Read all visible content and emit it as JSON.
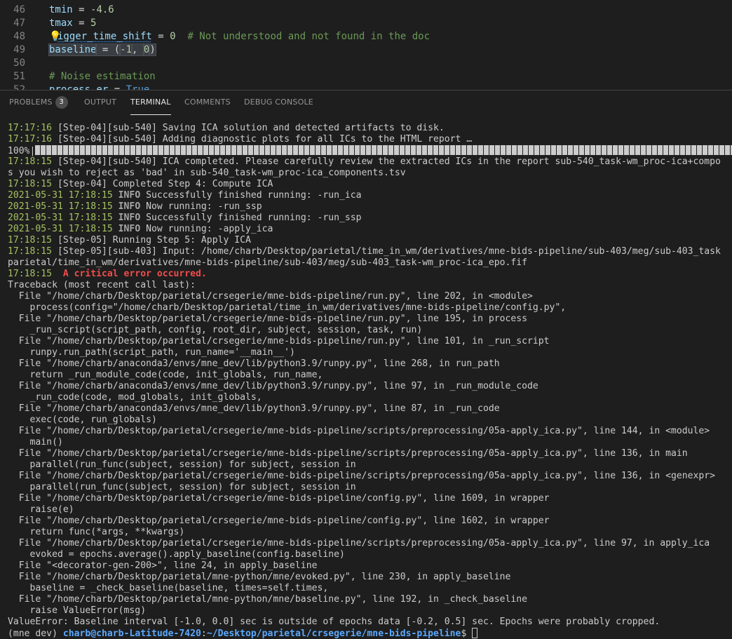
{
  "editor": {
    "lines": [
      {
        "num": "46",
        "var": "tmin",
        "op": " = ",
        "val": "-4.6"
      },
      {
        "num": "47",
        "var": "tmax",
        "op": " = ",
        "val": "5"
      },
      {
        "num": "48",
        "var": "igger_time_shift",
        "op": " = ",
        "val": "0",
        "comment": "  # Not understood and not found in the doc"
      },
      {
        "num": "49",
        "var": "baseline",
        "op": " = (",
        "val": "-1",
        "sep": ", ",
        "val2": "0",
        "close": ")"
      },
      {
        "num": "50"
      },
      {
        "num": "51",
        "comment": "# Noise estimation"
      },
      {
        "num": "52",
        "var": "process_er",
        "op": " = ",
        "val": "True"
      }
    ]
  },
  "panel": {
    "tabs": [
      {
        "label": "PROBLEMS",
        "badge": "3"
      },
      {
        "label": "OUTPUT"
      },
      {
        "label": "TERMINAL"
      },
      {
        "label": "COMMENTS"
      },
      {
        "label": "DEBUG CONSOLE"
      }
    ],
    "active_tab": "TERMINAL"
  },
  "terminal": {
    "lines": [
      {
        "ts": "17:17:16",
        "text": " [Step-04][sub-540] Saving ICA solution and detected artifacts to disk."
      },
      {
        "ts": "17:17:16",
        "text": " [Step-04][sub-540] Adding diagnostic plots for all ICs to the HTML report …"
      },
      {
        "progress": "100%|"
      },
      {
        "ts": "17:18:15",
        "text": " [Step-04][sub-540] ICA completed. Please carefully review the extracted ICs in the report sub-540_task-wm_proc-ica+compo"
      },
      {
        "text": "s you wish to reject as 'bad' in sub-540_task-wm_proc-ica_components.tsv"
      },
      {
        "ts": "17:18:15",
        "text": " [Step-04] Completed Step 4: Compute ICA"
      },
      {
        "ts": "2021-05-31 17:18:15",
        "level": " INFO",
        "text": " Successfully finished running: -run_ica"
      },
      {
        "ts": "2021-05-31 17:18:15",
        "level": " INFO",
        "text": " Now running: -run_ssp"
      },
      {
        "ts": "2021-05-31 17:18:15",
        "level": " INFO",
        "text": " Successfully finished running: -run_ssp"
      },
      {
        "ts": "2021-05-31 17:18:15",
        "level": " INFO",
        "text": " Now running: -apply_ica"
      },
      {
        "ts": "17:18:15",
        "text": " [Step-05] Running Step 5: Apply ICA"
      },
      {
        "ts": "17:18:15",
        "text": " [Step-05][sub-403] Input: /home/charb/Desktop/parietal/time_in_wm/derivatives/mne-bids-pipeline/sub-403/meg/sub-403_task"
      },
      {
        "text": "parietal/time_in_wm/derivatives/mne-bids-pipeline/sub-403/meg/sub-403_task-wm_proc-ica_epo.fif"
      },
      {
        "ts": "17:18:15",
        "error": "  A critical error occurred."
      },
      {
        "text": "Traceback (most recent call last):"
      },
      {
        "text": "  File \"/home/charb/Desktop/parietal/crsegerie/mne-bids-pipeline/run.py\", line 202, in <module>"
      },
      {
        "text": "    process(config=\"/home/charb/Desktop/parietal/time_in_wm/derivatives/mne-bids-pipeline/config.py\","
      },
      {
        "text": "  File \"/home/charb/Desktop/parietal/crsegerie/mne-bids-pipeline/run.py\", line 195, in process"
      },
      {
        "text": "    _run_script(script_path, config, root_dir, subject, session, task, run)"
      },
      {
        "text": "  File \"/home/charb/Desktop/parietal/crsegerie/mne-bids-pipeline/run.py\", line 101, in _run_script"
      },
      {
        "text": "    runpy.run_path(script_path, run_name='__main__')"
      },
      {
        "text": "  File \"/home/charb/anaconda3/envs/mne_dev/lib/python3.9/runpy.py\", line 268, in run_path"
      },
      {
        "text": "    return _run_module_code(code, init_globals, run_name,"
      },
      {
        "text": "  File \"/home/charb/anaconda3/envs/mne_dev/lib/python3.9/runpy.py\", line 97, in _run_module_code"
      },
      {
        "text": "    _run_code(code, mod_globals, init_globals,"
      },
      {
        "text": "  File \"/home/charb/anaconda3/envs/mne_dev/lib/python3.9/runpy.py\", line 87, in _run_code"
      },
      {
        "text": "    exec(code, run_globals)"
      },
      {
        "text": "  File \"/home/charb/Desktop/parietal/crsegerie/mne-bids-pipeline/scripts/preprocessing/05a-apply_ica.py\", line 144, in <module>"
      },
      {
        "text": "    main()"
      },
      {
        "text": "  File \"/home/charb/Desktop/parietal/crsegerie/mne-bids-pipeline/scripts/preprocessing/05a-apply_ica.py\", line 136, in main"
      },
      {
        "text": "    parallel(run_func(subject, session) for subject, session in"
      },
      {
        "text": "  File \"/home/charb/Desktop/parietal/crsegerie/mne-bids-pipeline/scripts/preprocessing/05a-apply_ica.py\", line 136, in <genexpr>"
      },
      {
        "text": "    parallel(run_func(subject, session) for subject, session in"
      },
      {
        "text": "  File \"/home/charb/Desktop/parietal/crsegerie/mne-bids-pipeline/config.py\", line 1609, in wrapper"
      },
      {
        "text": "    raise(e)"
      },
      {
        "text": "  File \"/home/charb/Desktop/parietal/crsegerie/mne-bids-pipeline/config.py\", line 1602, in wrapper"
      },
      {
        "text": "    return func(*args, **kwargs)"
      },
      {
        "text": "  File \"/home/charb/Desktop/parietal/crsegerie/mne-bids-pipeline/scripts/preprocessing/05a-apply_ica.py\", line 97, in apply_ica"
      },
      {
        "text": "    evoked = epochs.average().apply_baseline(config.baseline)"
      },
      {
        "text": "  File \"<decorator-gen-200>\", line 24, in apply_baseline"
      },
      {
        "text": "  File \"/home/charb/Desktop/parietal/mne-python/mne/evoked.py\", line 230, in apply_baseline"
      },
      {
        "text": "    baseline = _check_baseline(baseline, times=self.times,"
      },
      {
        "text": "  File \"/home/charb/Desktop/parietal/mne-python/mne/baseline.py\", line 192, in _check_baseline"
      },
      {
        "text": "    raise ValueError(msg)"
      },
      {
        "text": "ValueError: Baseline interval [-1.0, 0.0] sec is outside of epochs data [-0.2, 0.5] sec. Epochs were probably cropped."
      }
    ],
    "prompt": {
      "env": "(mne dev) ",
      "user": "charb@charb-Latitude-7420",
      "colon": ":",
      "path": "~/Desktop/parietal/crsegerie/mne-bids-pipeline",
      "symbol": "$ "
    }
  },
  "colors": {
    "background": "#1e1e1e",
    "timestamp": "#a5c261",
    "error": "#f14c4c",
    "prompt": "#5aa9ff"
  }
}
